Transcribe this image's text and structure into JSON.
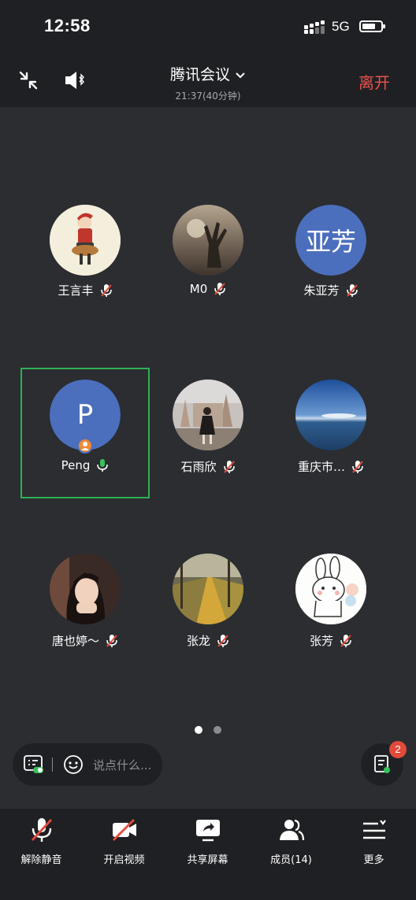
{
  "status_bar": {
    "time": "12:58",
    "network": "5G"
  },
  "header": {
    "title": "腾讯会议",
    "subtitle": "21:37(40分钟)",
    "leave_label": "离开"
  },
  "participants": [
    {
      "name": "王言丰",
      "mic": "muted",
      "avatar": "cartoon-girl-violin"
    },
    {
      "name": "M0",
      "mic": "muted",
      "avatar": "hand-sunset-photo"
    },
    {
      "name": "朱亚芳",
      "mic": "muted",
      "avatar_text": "亚芳"
    },
    {
      "name": "Peng",
      "mic": "on",
      "avatar_text": "P",
      "active": true,
      "host": true
    },
    {
      "name": "石雨欣",
      "mic": "muted",
      "avatar": "castle-girl-photo"
    },
    {
      "name": "重庆市…",
      "mic": "muted",
      "avatar": "lake-sky-photo"
    },
    {
      "name": "唐也婷～",
      "mic": "muted",
      "avatar": "woman-portrait-photo"
    },
    {
      "name": "张龙",
      "mic": "muted",
      "avatar": "autumn-path-photo"
    },
    {
      "name": "张芳",
      "mic": "muted",
      "avatar": "cartoon-bunny"
    }
  ],
  "pagination": {
    "current": 1,
    "total": 2
  },
  "chat": {
    "placeholder": "说点什么..."
  },
  "notes": {
    "badge_count": "2"
  },
  "toolbar": {
    "unmute": "解除静音",
    "video": "开启视频",
    "share": "共享屏幕",
    "members": "成员(14)",
    "more": "更多"
  },
  "colors": {
    "background": "#2b2d31",
    "bar": "#1f2023",
    "leave": "#e8534e",
    "active_border": "#2fb054",
    "avatar_blue": "#4b6fbd",
    "muted_red": "#e24a3b",
    "mic_green": "#36c25b"
  }
}
